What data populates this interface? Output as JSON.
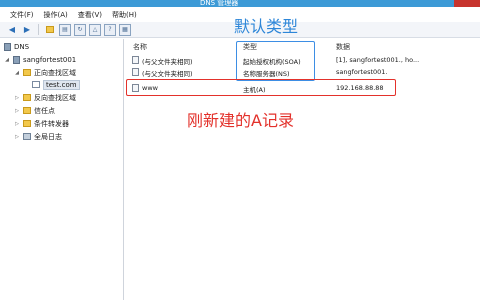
{
  "window": {
    "title": "DNS 管理器"
  },
  "menu": [
    "文件(F)",
    "操作(A)",
    "查看(V)",
    "帮助(H)"
  ],
  "toolbar": {
    "icons": [
      "back-arrow-icon",
      "forward-arrow-icon",
      "folder-up-icon",
      "properties-icon",
      "refresh-icon",
      "export-icon",
      "help-icon",
      "console-icon"
    ]
  },
  "tree": {
    "root": "DNS",
    "server": "sangfortest001",
    "forward_zones": "正向查找区域",
    "zone": "test.com",
    "reverse_zones": "反向查找区域",
    "trust_points": "信任点",
    "conditional_forwarders": "条件转发器",
    "global_logs": "全局日志"
  },
  "columns": {
    "name": "名称",
    "type": "类型",
    "data": "数据"
  },
  "records": [
    {
      "name": "(与父文件夹相同)",
      "type": "起始授权机构(SOA)",
      "data": "[1], sangfortest001., ho..."
    },
    {
      "name": "(与父文件夹相同)",
      "type": "名称服务器(NS)",
      "data": "sangfortest001."
    },
    {
      "name": "www",
      "type": "主机(A)",
      "data": "192.168.88.88"
    }
  ],
  "annotations": {
    "type_label": "默认类型",
    "new_record_label": "刚新建的A记录"
  },
  "colors": {
    "annotation_blue": "#2d86d8",
    "annotation_red": "#e3312b",
    "titlebar": "#3c9ad6"
  }
}
